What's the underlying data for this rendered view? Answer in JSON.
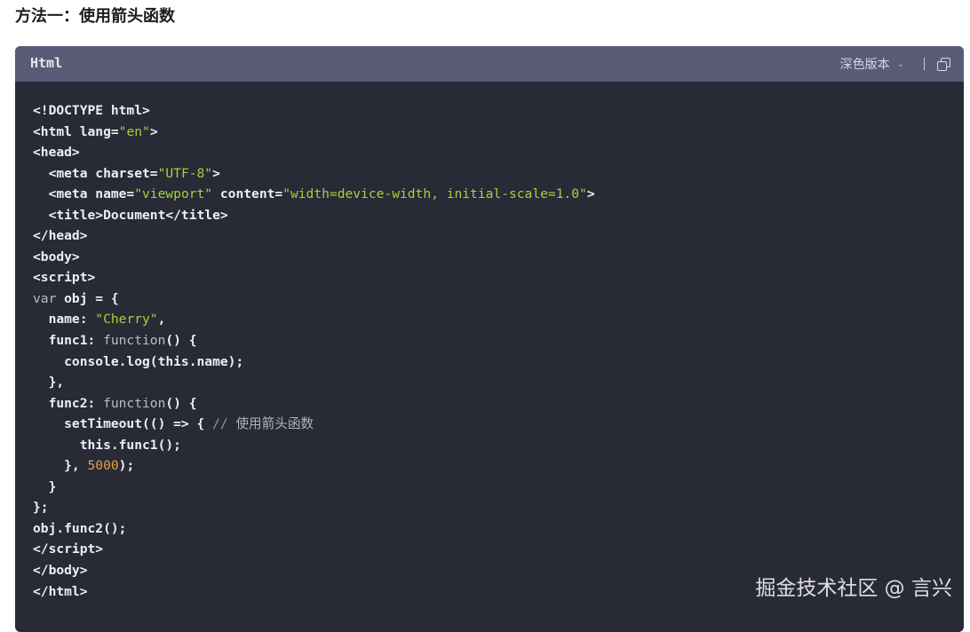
{
  "heading": "方法一：使用箭头函数",
  "code_block": {
    "language": "Html",
    "theme_label": "深色版本",
    "copy_icon": "copy-icon",
    "lines": [
      [
        [
          "<!DOCTYPE html>",
          "t"
        ]
      ],
      [
        [
          "<html lang=",
          "t"
        ],
        [
          "\"en\"",
          "str"
        ],
        [
          ">",
          "t"
        ]
      ],
      [
        [
          "<head>",
          "t"
        ]
      ],
      [
        [
          "  <meta charset=",
          "t"
        ],
        [
          "\"UTF-8\"",
          "str"
        ],
        [
          ">",
          "t"
        ]
      ],
      [
        [
          "  <meta name=",
          "t"
        ],
        [
          "\"viewport\"",
          "str"
        ],
        [
          " content=",
          "t"
        ],
        [
          "\"width=device-width, initial-scale=1.0\"",
          "str"
        ],
        [
          ">",
          "t"
        ]
      ],
      [
        [
          "  <title>Document</title>",
          "t"
        ]
      ],
      [
        [
          "</head>",
          "t"
        ]
      ],
      [
        [
          "<body>",
          "t"
        ]
      ],
      [
        [
          "<script>",
          "t"
        ]
      ],
      [
        [
          "var",
          "kw"
        ],
        [
          " obj = {",
          "t"
        ]
      ],
      [
        [
          "  name: ",
          "t"
        ],
        [
          "\"Cherry\"",
          "str"
        ],
        [
          ",",
          "t"
        ]
      ],
      [
        [
          "  func1: ",
          "t"
        ],
        [
          "function",
          "kw"
        ],
        [
          "() {",
          "t"
        ]
      ],
      [
        [
          "    console.log(this.name);",
          "t"
        ]
      ],
      [
        [
          "  },",
          "t"
        ]
      ],
      [
        [
          "  func2: ",
          "t"
        ],
        [
          "function",
          "kw"
        ],
        [
          "() {",
          "t"
        ]
      ],
      [
        [
          "    setTimeout(() => { ",
          "t"
        ],
        [
          "// ",
          "cm"
        ],
        [
          "使用箭头函数",
          "cmt"
        ]
      ],
      [
        [
          "      this.func1();",
          "t"
        ]
      ],
      [
        [
          "    }, ",
          "t"
        ],
        [
          "5000",
          "num"
        ],
        [
          ");",
          "t"
        ]
      ],
      [
        [
          "  }",
          "t"
        ]
      ],
      [
        [
          "};",
          "t"
        ]
      ],
      [
        [
          "obj.func2();",
          "t"
        ]
      ],
      [
        [
          "</script>",
          "t"
        ]
      ],
      [
        [
          "</body>",
          "t"
        ]
      ],
      [
        [
          "</html>",
          "t"
        ]
      ]
    ]
  },
  "watermark": "掘金技术社区 @ 言兴"
}
